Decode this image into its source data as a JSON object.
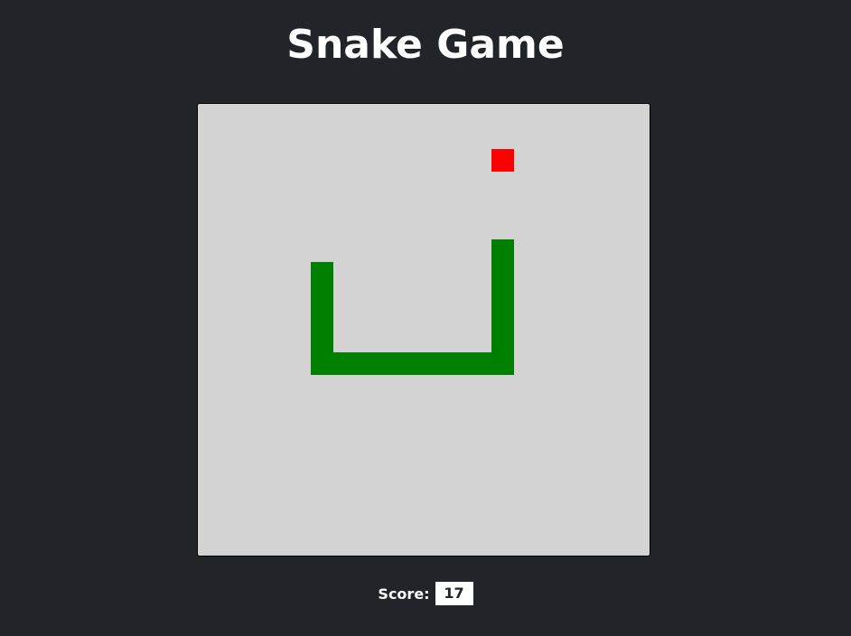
{
  "title": "Snake Game",
  "score": {
    "label": "Score:",
    "value": "17"
  },
  "colors": {
    "background": "#212429",
    "board": "#d3d3d3",
    "snake": "#008000",
    "food": "#ff0000"
  },
  "game": {
    "grid_cols": 20,
    "grid_rows": 20,
    "food": [
      13,
      2
    ],
    "snake": [
      [
        13,
        6
      ],
      [
        13,
        7
      ],
      [
        13,
        8
      ],
      [
        13,
        9
      ],
      [
        13,
        10
      ],
      [
        13,
        11
      ],
      [
        12,
        11
      ],
      [
        11,
        11
      ],
      [
        10,
        11
      ],
      [
        9,
        11
      ],
      [
        8,
        11
      ],
      [
        7,
        11
      ],
      [
        6,
        11
      ],
      [
        5,
        11
      ],
      [
        5,
        10
      ],
      [
        5,
        9
      ],
      [
        5,
        8
      ],
      [
        5,
        7
      ]
    ]
  }
}
